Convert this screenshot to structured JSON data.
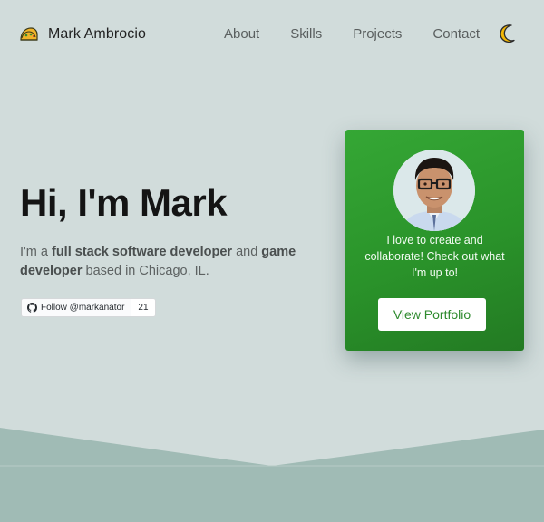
{
  "nav": {
    "brand_name": "Mark Ambrocio",
    "brand_icon": "taco-icon",
    "links": [
      "About",
      "Skills",
      "Projects",
      "Contact"
    ],
    "theme_toggle_icon": "moon-icon"
  },
  "hero": {
    "title": "Hi, I'm Mark",
    "desc_prefix": "I'm a ",
    "desc_bold1": "full stack software developer",
    "desc_mid": " and ",
    "desc_bold2": "game developer",
    "desc_suffix": " based in Chicago, IL.",
    "github_follow_label": "Follow @markanator",
    "github_follow_count": "21"
  },
  "card": {
    "text": "I love to create and collaborate! Check out what I'm up to!",
    "button_label": "View Portfolio"
  },
  "colors": {
    "background": "#d1dcdb",
    "card_green": "#2e9c2e",
    "wave": "#a0bbb5"
  }
}
